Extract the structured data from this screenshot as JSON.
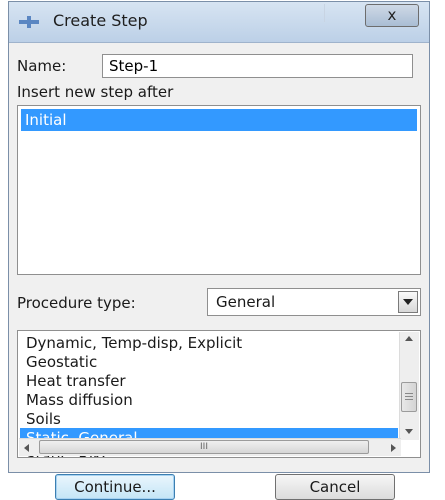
{
  "window": {
    "title": "Create Step",
    "close_symbol": "x",
    "title_icon": "plus-icon"
  },
  "form": {
    "name_label": "Name:",
    "name_value": "Step-1",
    "insert_label": "Insert new step after",
    "steps": [
      "Initial"
    ],
    "selected_step": "Initial",
    "procedure_label": "Procedure type:",
    "procedure_value": "General",
    "procedures": [
      "Dynamic, Temp-disp, Explicit",
      "Geostatic",
      "Heat transfer",
      "Mass diffusion",
      "Soils",
      "Static, General",
      "Static, Riks"
    ],
    "selected_procedure": "Static, General",
    "scroll_grip": "III"
  },
  "buttons": {
    "continue": "Continue...",
    "cancel": "Cancel"
  },
  "colors": {
    "selection": "#3399ff",
    "title_bar": "#bcd0e7"
  }
}
